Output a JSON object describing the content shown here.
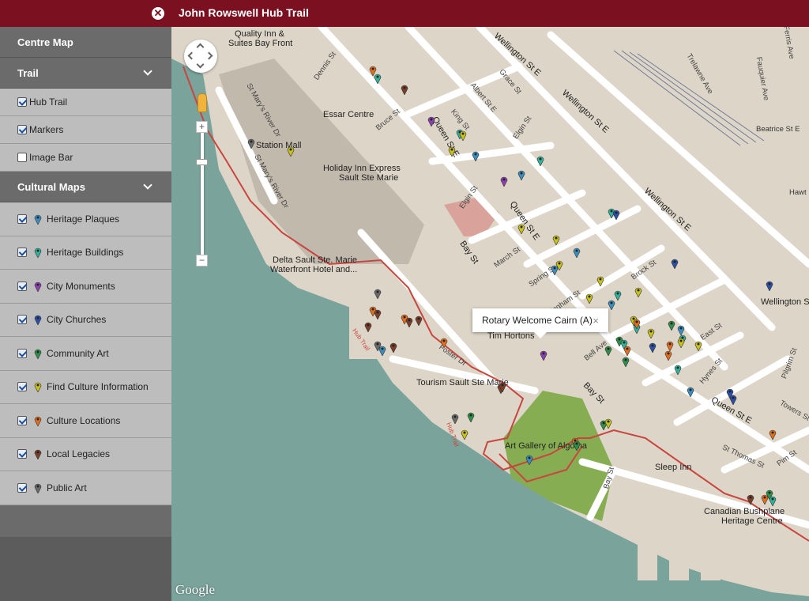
{
  "app": {
    "title": "John Rowswell Hub Trail"
  },
  "sidebar": {
    "centre_map": "Centre Map",
    "trail_header": "Trail",
    "trail_items": [
      {
        "label": "Hub Trail",
        "checked": true
      },
      {
        "label": "Markers",
        "checked": true
      },
      {
        "label": "Image Bar",
        "checked": false
      }
    ],
    "cultural_header": "Cultural Maps",
    "cultural_items": [
      {
        "label": "Heritage Plaques",
        "checked": true,
        "color": "#3a8fc0"
      },
      {
        "label": "Heritage Buildings",
        "checked": true,
        "color": "#2fb39a"
      },
      {
        "label": "City Monuments",
        "checked": true,
        "color": "#8e3fb0"
      },
      {
        "label": "City Churches",
        "checked": true,
        "color": "#2c4fa8"
      },
      {
        "label": "Community Art",
        "checked": true,
        "color": "#2e8f4a"
      },
      {
        "label": "Find Culture Information",
        "checked": true,
        "color": "#c9c21a"
      },
      {
        "label": "Culture Locations",
        "checked": true,
        "color": "#e36f1e"
      },
      {
        "label": "Local Legacies",
        "checked": true,
        "color": "#7a3e2a"
      },
      {
        "label": "Public Art",
        "checked": true,
        "color": "#6a6a6a"
      }
    ]
  },
  "map": {
    "info_window": {
      "text": "Rotary Welcome Cairn (A)",
      "close": "×"
    },
    "attribution": "Google",
    "labels": {
      "quality_inn": "Quality Inn &",
      "quality_inn2": "Suites Bay Front",
      "essar": "Essar Centre",
      "station_mall": "Station Mall",
      "holiday_inn": "Holiday Inn Express",
      "holiday_inn2": "Sault Ste Marie",
      "delta": "Delta Sault Ste. Marie",
      "delta2": "Waterfront Hotel and...",
      "tim": "Tim Hortons",
      "tourism": "Tourism Sault Ste Marie",
      "art_gallery": "Art Gallery of Algoma",
      "sleep_inn": "Sleep Inn",
      "bushplane": "Canadian Bushplane",
      "bushplane2": "Heritage Centre",
      "beatrice": "Beatrice St E",
      "hawt": "Hawt",
      "wellington_s": "Wellington S",
      "dennis": "Dennis St",
      "bruce": "Bruce St",
      "queen_e": "Queen St E",
      "bay": "Bay St",
      "elgin": "Elgin St",
      "albert": "Albert St E",
      "grace": "Grace St",
      "king": "King St",
      "march": "March St",
      "spring": "Spring St",
      "brock": "Brock St",
      "east": "East St",
      "hynes": "Hynes St",
      "pilgrim": "Pilgrim St",
      "towers": "Towers St",
      "st_thomas": "St Thomas St",
      "pim": "Pim St",
      "trelawne": "Trelawne Ave",
      "fluquier": "Fauquier Ave",
      "wellington_e": "Wellington St E",
      "st_marys": "St Mary's River Dr",
      "foster": "Foster Dr",
      "hub_trail": "Hub Trail",
      "bell": "Bell Ave",
      "bingham": "Bingham St",
      "ferris": "Ferris Ave"
    }
  }
}
